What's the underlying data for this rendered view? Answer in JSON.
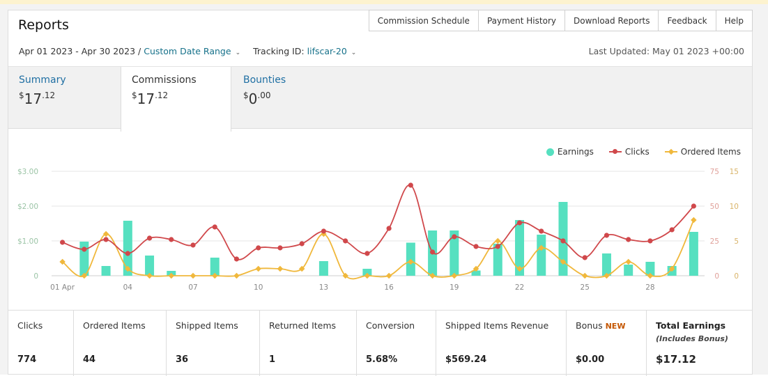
{
  "page": {
    "title": "Reports"
  },
  "top_nav": [
    "Commission Schedule",
    "Payment History",
    "Download Reports",
    "Feedback",
    "Help"
  ],
  "filters": {
    "date_range": "Apr 01 2023 - Apr 30 2023 /",
    "custom_range_label": "Custom Date Range",
    "tracking_label": "Tracking ID:",
    "tracking_id": "lifscar-20",
    "last_updated": "Last Updated: May 01 2023 +00:00"
  },
  "tabs": [
    {
      "label": "Summary",
      "symbol": "$",
      "whole": "17",
      "cents": ".12"
    },
    {
      "label": "Commissions",
      "symbol": "$",
      "whole": "17",
      "cents": ".12"
    },
    {
      "label": "Bounties",
      "symbol": "$",
      "whole": "0",
      "cents": ".00"
    }
  ],
  "colors": {
    "earnings": "#56e0c0",
    "clicks": "#d0484b",
    "ordered_items": "#f0b83c",
    "link": "#16718a",
    "new_badge": "#c45500"
  },
  "chart_data": {
    "type": "bar+line",
    "legend": [
      "Earnings",
      "Clicks",
      "Ordered Items"
    ],
    "legend_position": "top-right",
    "grid": true,
    "x": [
      "01 Apr",
      "02",
      "03",
      "04",
      "05",
      "06",
      "07",
      "08",
      "09",
      "10",
      "11",
      "12",
      "13",
      "14",
      "15",
      "16",
      "17",
      "18",
      "19",
      "20",
      "21",
      "22",
      "23",
      "24",
      "25",
      "26",
      "27",
      "28",
      "29",
      "30"
    ],
    "x_tick_labels": [
      "01 Apr",
      "04",
      "07",
      "10",
      "13",
      "16",
      "19",
      "22",
      "25",
      "28"
    ],
    "left_axis": {
      "ticks": [
        "$3.00",
        "$2.00",
        "$1.00",
        "0"
      ],
      "range": [
        0,
        3
      ]
    },
    "right_axis_clicks": {
      "ticks": [
        "75",
        "50",
        "25",
        "0"
      ],
      "range": [
        0,
        75
      ]
    },
    "right_axis_items": {
      "ticks": [
        "15",
        "10",
        "5",
        "0"
      ],
      "range": [
        0,
        15
      ]
    },
    "series": [
      {
        "name": "Earnings",
        "type": "bar",
        "axis": "left",
        "values": [
          0,
          0.98,
          0.28,
          1.58,
          0.58,
          0.14,
          0,
          0.52,
          0,
          0,
          0,
          0,
          0.42,
          0,
          0.2,
          0,
          0.95,
          1.3,
          1.3,
          0.15,
          0.92,
          1.6,
          1.18,
          2.12,
          0,
          0.64,
          0.32,
          0.4,
          0.28,
          1.26
        ]
      },
      {
        "name": "Clicks",
        "type": "line",
        "axis": "right_clicks",
        "values": [
          24,
          19,
          26,
          16,
          27,
          26,
          22,
          35,
          12,
          20,
          20,
          23,
          32,
          25,
          16,
          34,
          65,
          17,
          28,
          21,
          21,
          38,
          32,
          25,
          13,
          29,
          26,
          25,
          33,
          50
        ]
      },
      {
        "name": "Ordered Items",
        "type": "line",
        "axis": "right_items",
        "values": [
          2,
          0,
          6,
          1,
          0,
          0,
          0,
          0,
          0,
          1,
          1,
          1,
          6,
          0,
          0,
          0,
          2,
          0,
          0,
          1,
          5,
          1,
          4,
          2,
          0,
          0,
          2,
          0,
          1,
          8
        ]
      }
    ]
  },
  "stats": [
    {
      "label": "Clicks",
      "value": "774"
    },
    {
      "label": "Ordered Items",
      "value": "44"
    },
    {
      "label": "Shipped Items",
      "value": "36"
    },
    {
      "label": "Returned Items",
      "value": "1"
    },
    {
      "label": "Conversion",
      "value": "5.68%"
    },
    {
      "label": "Shipped Items Revenue",
      "value": "$569.24"
    },
    {
      "label": "Bonus",
      "new_badge": "NEW",
      "value": "$0.00"
    },
    {
      "label": "Total Earnings",
      "sublabel": "(Includes Bonus)",
      "value": "$17.12"
    }
  ]
}
